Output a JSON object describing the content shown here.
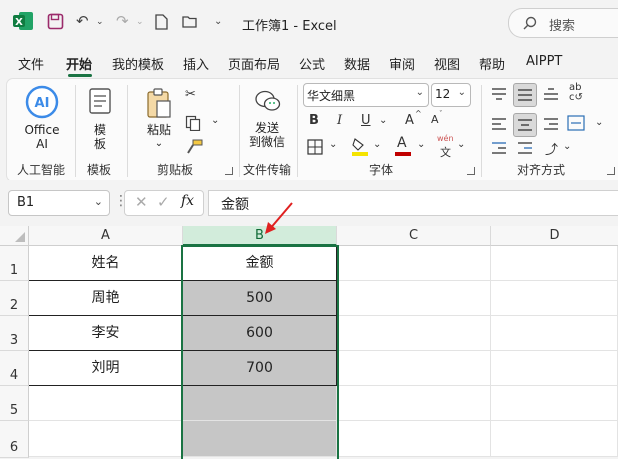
{
  "app": {
    "title": "工作簿1 - Excel"
  },
  "search": {
    "label": "搜索"
  },
  "menu": [
    "文件",
    "开始",
    "我的模板",
    "插入",
    "页面布局",
    "公式",
    "数据",
    "审阅",
    "视图",
    "帮助",
    "AIPPT"
  ],
  "ribbon": {
    "office_ai": {
      "line1": "Office",
      "line2": "AI",
      "group": "人工智能"
    },
    "template": {
      "line1": "模",
      "line2": "板",
      "group": "模板"
    },
    "clipboard": {
      "paste": "粘贴",
      "group": "剪贴板"
    },
    "file_transfer": {
      "line1": "发送",
      "line2": "到微信",
      "group": "文件传输"
    },
    "font": {
      "name": "华文细黑",
      "size": "12",
      "group": "字体",
      "bold": "B",
      "italic": "I",
      "underline": "U",
      "grow": "A",
      "shrink": "A",
      "font_color": "A",
      "phonetic_top": "wén",
      "phonetic_bottom": "文"
    },
    "alignment": {
      "group": "对齐方式"
    },
    "accent_color": "#1a7343",
    "highlight_color": "#f5e400",
    "font_color_bar": "#c00000"
  },
  "formula_bar": {
    "name_box": "B1",
    "fx": "fx",
    "value": "金额"
  },
  "sheet": {
    "columns": [
      "A",
      "B",
      "C",
      "D"
    ],
    "rows": [
      "1",
      "2",
      "3",
      "4",
      "5",
      "6"
    ],
    "cells": {
      "A1": "姓名",
      "B1": "金额",
      "A2": "周艳",
      "B2": "500",
      "A3": "李安",
      "B3": "600",
      "A4": "刘明",
      "B4": "700"
    },
    "selected_column": "B",
    "selection_fill": "#c6c6c6"
  }
}
